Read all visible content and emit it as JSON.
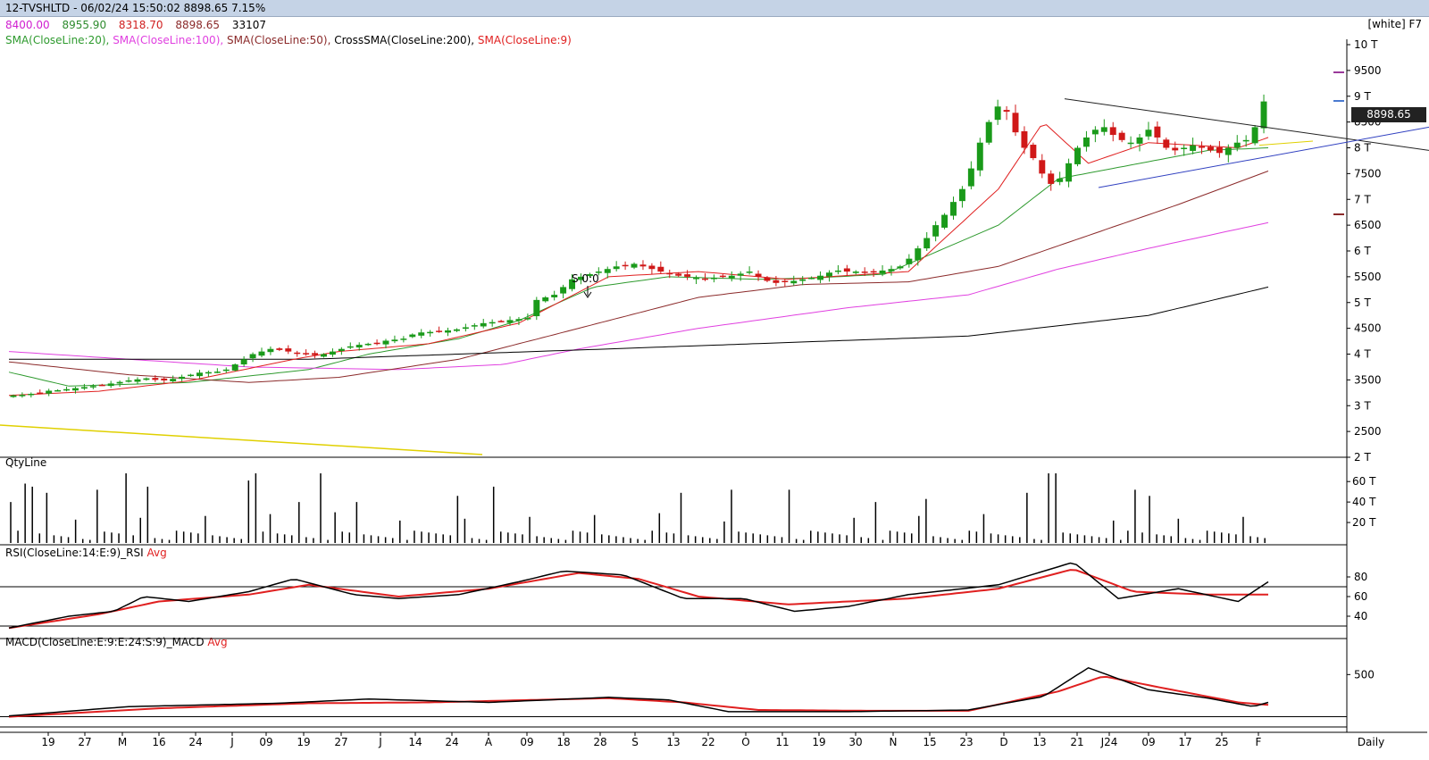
{
  "header": {
    "title": "12-TVSHLTD - 06/02/24 15:50:02 8898.65 7.15%"
  },
  "ohlc": {
    "open": "8400.00",
    "high": "8955.90",
    "low": "8318.70",
    "close": "8898.65",
    "volume": "33107"
  },
  "indicators": [
    {
      "label": "SMA(CloseLine:20),",
      "color": "#2e9a2e"
    },
    {
      "label": " SMA(CloseLine:100),",
      "color": "#e040e0"
    },
    {
      "label": " SMA(CloseLine:50),",
      "color": "#8b2a2a"
    },
    {
      "label": " CrossSMA(CloseLine:200),",
      "color": "#000000"
    },
    {
      "label": " SMA(CloseLine:9)",
      "color": "#e02020"
    }
  ],
  "corner_label": "[white] F7",
  "last_price": "8898.65",
  "signal_label": "S 0:0",
  "timeframe": "Daily",
  "panels": {
    "volume": "QtyLine",
    "rsi": {
      "label": "RSI(CloseLine:14:E:9)_RSI",
      "avg": "Avg"
    },
    "macd": {
      "label": "MACD(CloseLine:E:9:E:24:S:9)_MACD",
      "avg": "Avg"
    }
  },
  "chart_data": {
    "type": "candlestick",
    "price_axis": {
      "ticks": [
        "10 T",
        "9500",
        "9 T",
        "8500",
        "8 T",
        "7500",
        "7 T",
        "6500",
        "6 T",
        "5500",
        "5 T",
        "4500",
        "4 T",
        "3500",
        "3 T",
        "2500",
        "2 T"
      ],
      "ylim": [
        2000,
        10000
      ]
    },
    "x_tick_labels": [
      "19",
      "27",
      "M",
      "16",
      "24",
      "J",
      "09",
      "19",
      "27",
      "J",
      "14",
      "24",
      "A",
      "09",
      "18",
      "28",
      "S",
      "13",
      "22",
      "O",
      "11",
      "19",
      "30",
      "N",
      "15",
      "23",
      "D",
      "13",
      "21",
      "J24",
      "09",
      "17",
      "25",
      "F"
    ],
    "close_path": [
      3200,
      3210,
      3230,
      3250,
      3290,
      3300,
      3320,
      3340,
      3360,
      3380,
      3400,
      3430,
      3460,
      3490,
      3510,
      3530,
      3500,
      3490,
      3520,
      3560,
      3600,
      3640,
      3650,
      3660,
      3700,
      3800,
      3900,
      4000,
      4050,
      4100,
      4080,
      4050,
      4020,
      4000,
      3980,
      4000,
      4050,
      4100,
      4150,
      4180,
      4200,
      4220,
      4260,
      4280,
      4300,
      4380,
      4420,
      4430,
      4450,
      4460,
      4480,
      4520,
      4560,
      4600,
      4620,
      4640,
      4660,
      4680,
      4700,
      5050,
      5100,
      5150,
      5300,
      5450,
      5500,
      5550,
      5600,
      5650,
      5700,
      5720,
      5750,
      5700,
      5650,
      5600,
      5560,
      5520,
      5500,
      5480,
      5460,
      5480,
      5500,
      5520,
      5560,
      5600,
      5500,
      5420,
      5380,
      5400,
      5420,
      5450,
      5480,
      5520,
      5580,
      5620,
      5600,
      5600,
      5580,
      5600,
      5620,
      5650,
      5700,
      5850,
      6050,
      6250,
      6500,
      6700,
      6950,
      7200,
      7600,
      8100,
      8500,
      8800,
      8700,
      8300,
      8000,
      7800,
      7500,
      7300,
      7400,
      7700,
      8000,
      8200,
      8350,
      8400,
      8250,
      8150,
      8100,
      8200,
      8350,
      8200,
      8000,
      7950,
      8000,
      8050,
      8000,
      7950,
      7900,
      8000,
      8100,
      8150,
      8400,
      8898.65
    ],
    "series": [
      {
        "name": "SMA(CloseLine:20)",
        "points": [
          [
            0,
            3650
          ],
          [
            20,
            3380
          ],
          [
            60,
            3450
          ],
          [
            100,
            3700
          ],
          [
            120,
            4000
          ],
          [
            150,
            4300
          ],
          [
            170,
            4650
          ],
          [
            195,
            5300
          ],
          [
            220,
            5500
          ],
          [
            250,
            5450
          ],
          [
            270,
            5480
          ],
          [
            292,
            5550
          ],
          [
            330,
            6500
          ],
          [
            350,
            7400
          ],
          [
            400,
            7950
          ],
          [
            420,
            8000
          ]
        ]
      },
      {
        "name": "SMA(CloseLine:100)",
        "points": [
          [
            0,
            4050
          ],
          [
            40,
            3900
          ],
          [
            80,
            3750
          ],
          [
            130,
            3700
          ],
          [
            165,
            3800
          ],
          [
            190,
            4100
          ],
          [
            230,
            4500
          ],
          [
            280,
            4900
          ],
          [
            320,
            5150
          ],
          [
            350,
            5650
          ],
          [
            380,
            6050
          ],
          [
            420,
            6550
          ]
        ]
      },
      {
        "name": "SMA(CloseLine:50)",
        "points": [
          [
            0,
            3850
          ],
          [
            40,
            3600
          ],
          [
            80,
            3450
          ],
          [
            110,
            3550
          ],
          [
            150,
            3900
          ],
          [
            190,
            4500
          ],
          [
            230,
            5100
          ],
          [
            265,
            5350
          ],
          [
            300,
            5400
          ],
          [
            330,
            5700
          ],
          [
            360,
            6300
          ],
          [
            390,
            6900
          ],
          [
            420,
            7550
          ]
        ]
      },
      {
        "name": "CrossSMA(CloseLine:200)",
        "points": [
          [
            0,
            3900
          ],
          [
            100,
            3900
          ],
          [
            200,
            4100
          ],
          [
            320,
            4350
          ],
          [
            380,
            4750
          ],
          [
            420,
            5300
          ]
        ]
      },
      {
        "name": "SMA(CloseLine:9)",
        "points": [
          [
            0,
            3200
          ],
          [
            30,
            3280
          ],
          [
            60,
            3480
          ],
          [
            95,
            3900
          ],
          [
            110,
            4050
          ],
          [
            140,
            4200
          ],
          [
            170,
            4600
          ],
          [
            200,
            5500
          ],
          [
            230,
            5600
          ],
          [
            260,
            5450
          ],
          [
            300,
            5600
          ],
          [
            330,
            7200
          ],
          [
            345,
            8500
          ],
          [
            360,
            7700
          ],
          [
            380,
            8100
          ],
          [
            410,
            8000
          ],
          [
            420,
            8200
          ]
        ]
      }
    ],
    "volume_axis": {
      "ticks": [
        "60 T",
        "40 T",
        "20 T"
      ],
      "ylim": [
        0,
        75000
      ]
    },
    "rsi_axis": {
      "ticks": [
        "80",
        "60",
        "40"
      ],
      "ylim": [
        20,
        100
      ],
      "levels": [
        70,
        30
      ]
    },
    "macd_axis": {
      "ticks": [
        "500"
      ],
      "ylim": [
        -100,
        800
      ]
    },
    "rsi_points": [
      [
        0,
        28
      ],
      [
        20,
        40
      ],
      [
        35,
        45
      ],
      [
        45,
        60
      ],
      [
        60,
        55
      ],
      [
        80,
        65
      ],
      [
        95,
        78
      ],
      [
        115,
        62
      ],
      [
        130,
        58
      ],
      [
        150,
        62
      ],
      [
        170,
        75
      ],
      [
        185,
        86
      ],
      [
        205,
        82
      ],
      [
        225,
        58
      ],
      [
        245,
        58
      ],
      [
        262,
        45
      ],
      [
        280,
        50
      ],
      [
        300,
        62
      ],
      [
        330,
        72
      ],
      [
        355,
        95
      ],
      [
        370,
        58
      ],
      [
        390,
        68
      ],
      [
        410,
        55
      ],
      [
        420,
        75
      ]
    ],
    "rsi_avg_points": [
      [
        0,
        28
      ],
      [
        30,
        42
      ],
      [
        50,
        55
      ],
      [
        80,
        62
      ],
      [
        100,
        72
      ],
      [
        130,
        60
      ],
      [
        160,
        68
      ],
      [
        190,
        84
      ],
      [
        210,
        78
      ],
      [
        230,
        60
      ],
      [
        260,
        52
      ],
      [
        300,
        58
      ],
      [
        330,
        68
      ],
      [
        355,
        88
      ],
      [
        375,
        65
      ],
      [
        400,
        62
      ],
      [
        420,
        62
      ]
    ],
    "macd_points": [
      [
        0,
        10
      ],
      [
        40,
        120
      ],
      [
        90,
        160
      ],
      [
        120,
        210
      ],
      [
        160,
        170
      ],
      [
        200,
        230
      ],
      [
        220,
        200
      ],
      [
        240,
        60
      ],
      [
        280,
        60
      ],
      [
        320,
        80
      ],
      [
        345,
        240
      ],
      [
        360,
        580
      ],
      [
        380,
        320
      ],
      [
        400,
        220
      ],
      [
        415,
        120
      ],
      [
        420,
        170
      ]
    ],
    "macd_avg_points": [
      [
        0,
        0
      ],
      [
        50,
        100
      ],
      [
        100,
        160
      ],
      [
        140,
        170
      ],
      [
        200,
        220
      ],
      [
        225,
        170
      ],
      [
        250,
        80
      ],
      [
        290,
        70
      ],
      [
        320,
        70
      ],
      [
        350,
        300
      ],
      [
        365,
        480
      ],
      [
        385,
        340
      ],
      [
        410,
        170
      ],
      [
        420,
        140
      ]
    ]
  }
}
